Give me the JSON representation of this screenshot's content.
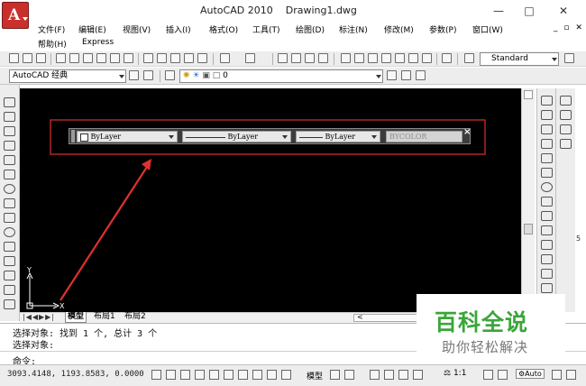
{
  "window": {
    "title": "AutoCAD 2010",
    "document": "Drawing1.dwg",
    "minimize": "—",
    "maximize": "□",
    "close": "✕"
  },
  "menu": {
    "items": [
      "文件(F)",
      "编辑(E)",
      "视图(V)",
      "插入(I)",
      "格式(O)",
      "工具(T)",
      "绘图(D)",
      "标注(N)",
      "修改(M)",
      "参数(P)",
      "窗口(W)"
    ],
    "items2": [
      "帮助(H)",
      "Express"
    ],
    "mdi_controls": "_ ▫ ✕"
  },
  "toolbar": {
    "text_style": "Standard"
  },
  "workspace": {
    "name": "AutoCAD 经典",
    "layer": "0"
  },
  "properties": {
    "color": "ByLayer",
    "linetype": "ByLayer",
    "lineweight": "ByLayer",
    "plotstyle": "BYCOLOR",
    "close": "×"
  },
  "ucs": {
    "x_label": "X",
    "y_label": "Y"
  },
  "tabs": [
    "模型",
    "布局1",
    "布局2"
  ],
  "command": {
    "lines": [
      "选择对象: 找到 1 个, 总计 3 个",
      "选择对象:"
    ],
    "prompt": "命令:"
  },
  "status": {
    "coords": "3093.4148, 1193.8583, 0.0000",
    "model_label": "模型",
    "scale": "1:1",
    "auto_label": "Auto"
  },
  "watermark": {
    "title": "百科全说",
    "subtitle": "助你轻松解决"
  },
  "colors": {
    "canvas": "#000000",
    "annotation_red": "#e03030",
    "logo_red": "#c9302c",
    "watermark_green": "#3aa63a"
  },
  "icons": [
    "autocad-logo-icon",
    "new-icon",
    "open-icon",
    "save-icon",
    "print-icon",
    "undo-icon",
    "redo-icon",
    "pan-icon",
    "zoom-icon",
    "help-icon",
    "layer-icon",
    "line-icon",
    "circle-icon",
    "arc-icon",
    "erase-icon",
    "copy-icon",
    "move-icon"
  ]
}
